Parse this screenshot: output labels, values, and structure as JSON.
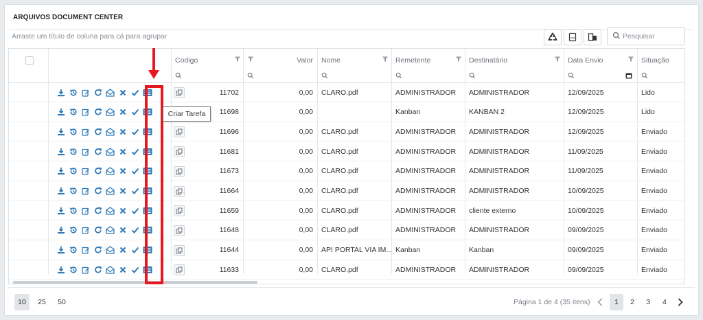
{
  "panel": {
    "title": "ARQUIVOS DOCUMENT CENTER"
  },
  "toolbar": {
    "group_hint": "Arraste um título de coluna para cá para agrupar",
    "search_placeholder": "Pesquisar",
    "icons": [
      "recycle-icon",
      "csv-export-icon",
      "column-chooser-icon",
      "search-icon"
    ]
  },
  "columns": {
    "codigo": "Codigo",
    "valor": "Valor",
    "nome": "Nome",
    "remetente": "Remetente",
    "destinatario": "Destinatário",
    "data_envio": "Data Envio",
    "situacao": "Situação"
  },
  "row_actions": [
    "download-icon",
    "history-icon",
    "edit-icon",
    "refresh-icon",
    "envelope-open-icon",
    "delete-icon",
    "check-icon",
    "tasks-icon"
  ],
  "rows": [
    {
      "codigo": "11702",
      "valor": "0,00",
      "nome": "CLARO.pdf",
      "remetente": "ADMINISTRADOR",
      "destinatario": "ADMINISTRADOR",
      "data": "12/09/2025",
      "situacao": "Lido"
    },
    {
      "codigo": "11698",
      "valor": "0,00",
      "nome": "",
      "remetente": "Kanban",
      "destinatario": "KANBAN 2",
      "data": "12/09/2025",
      "situacao": "Lido"
    },
    {
      "codigo": "11696",
      "valor": "0,00",
      "nome": "CLARO.pdf",
      "remetente": "ADMINISTRADOR",
      "destinatario": "ADMINISTRADOR",
      "data": "12/09/2025",
      "situacao": "Enviado"
    },
    {
      "codigo": "11681",
      "valor": "0,00",
      "nome": "CLARO.pdf",
      "remetente": "ADMINISTRADOR",
      "destinatario": "ADMINISTRADOR",
      "data": "11/09/2025",
      "situacao": "Enviado"
    },
    {
      "codigo": "11673",
      "valor": "0,00",
      "nome": "CLARO.pdf",
      "remetente": "ADMINISTRADOR",
      "destinatario": "ADMINISTRADOR",
      "data": "11/09/2025",
      "situacao": "Enviado"
    },
    {
      "codigo": "11664",
      "valor": "0,00",
      "nome": "CLARO.pdf",
      "remetente": "ADMINISTRADOR",
      "destinatario": "ADMINISTRADOR",
      "data": "10/09/2025",
      "situacao": "Enviado"
    },
    {
      "codigo": "11659",
      "valor": "0,00",
      "nome": "CLARO.pdf",
      "remetente": "ADMINISTRADOR",
      "destinatario": "cliente externo",
      "data": "10/09/2025",
      "situacao": "Enviado"
    },
    {
      "codigo": "11648",
      "valor": "0,00",
      "nome": "CLARO.pdf",
      "remetente": "ADMINISTRADOR",
      "destinatario": "ADMINISTRADOR",
      "data": "09/09/2025",
      "situacao": "Enviado"
    },
    {
      "codigo": "11644",
      "valor": "0,00",
      "nome": "API PORTAL VIA IM...",
      "remetente": "Kanban",
      "destinatario": "Kanban",
      "data": "09/09/2025",
      "situacao": "Enviado"
    },
    {
      "codigo": "11633",
      "valor": "0,00",
      "nome": "CLARO.pdf",
      "remetente": "ADMINISTRADOR",
      "destinatario": "ADMINISTRADOR",
      "data": "09/09/2025",
      "situacao": "Enviado"
    }
  ],
  "tooltip": {
    "text": "Criar Tarefa"
  },
  "pager": {
    "page_sizes": [
      "10",
      "25",
      "50"
    ],
    "selected_page_size": "10",
    "info": "Página 1 de 4 (35 itens)",
    "pages": [
      "1",
      "2",
      "3",
      "4"
    ],
    "current_page": "1"
  },
  "colors": {
    "action_icon": "#2f7ab8",
    "highlight": "#e8161f",
    "text": "#333333"
  }
}
